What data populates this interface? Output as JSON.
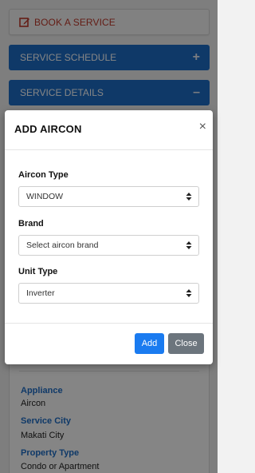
{
  "page": {
    "book_service_label": "BOOK A SERVICE",
    "service_schedule": {
      "label": "SERVICE SCHEDULE",
      "toggle": "+"
    },
    "service_details": {
      "label": "SERVICE DETAILS",
      "toggle": "–"
    },
    "details": [
      {
        "label": "Appliance",
        "value": "Aircon"
      },
      {
        "label": "Service City",
        "value": "Makati City"
      },
      {
        "label": "Property Type",
        "value": "Condo or Apartment"
      }
    ]
  },
  "modal": {
    "title": "ADD AIRCON",
    "close_glyph": "×",
    "fields": {
      "aircon_type": {
        "label": "Aircon Type",
        "value": "WINDOW"
      },
      "brand": {
        "label": "Brand",
        "value": "Select aircon brand"
      },
      "unit_type": {
        "label": "Unit Type",
        "value": "Inverter"
      }
    },
    "add_label": "Add",
    "close_label": "Close"
  },
  "colors": {
    "primary": "#1e6ec8",
    "add_button": "#1a7bf0",
    "close_button": "#6c757d",
    "book_text": "#c0392b"
  },
  "icons": {
    "book": "edit-icon",
    "select": "chevron-up-down-icon",
    "close": "close-icon"
  }
}
